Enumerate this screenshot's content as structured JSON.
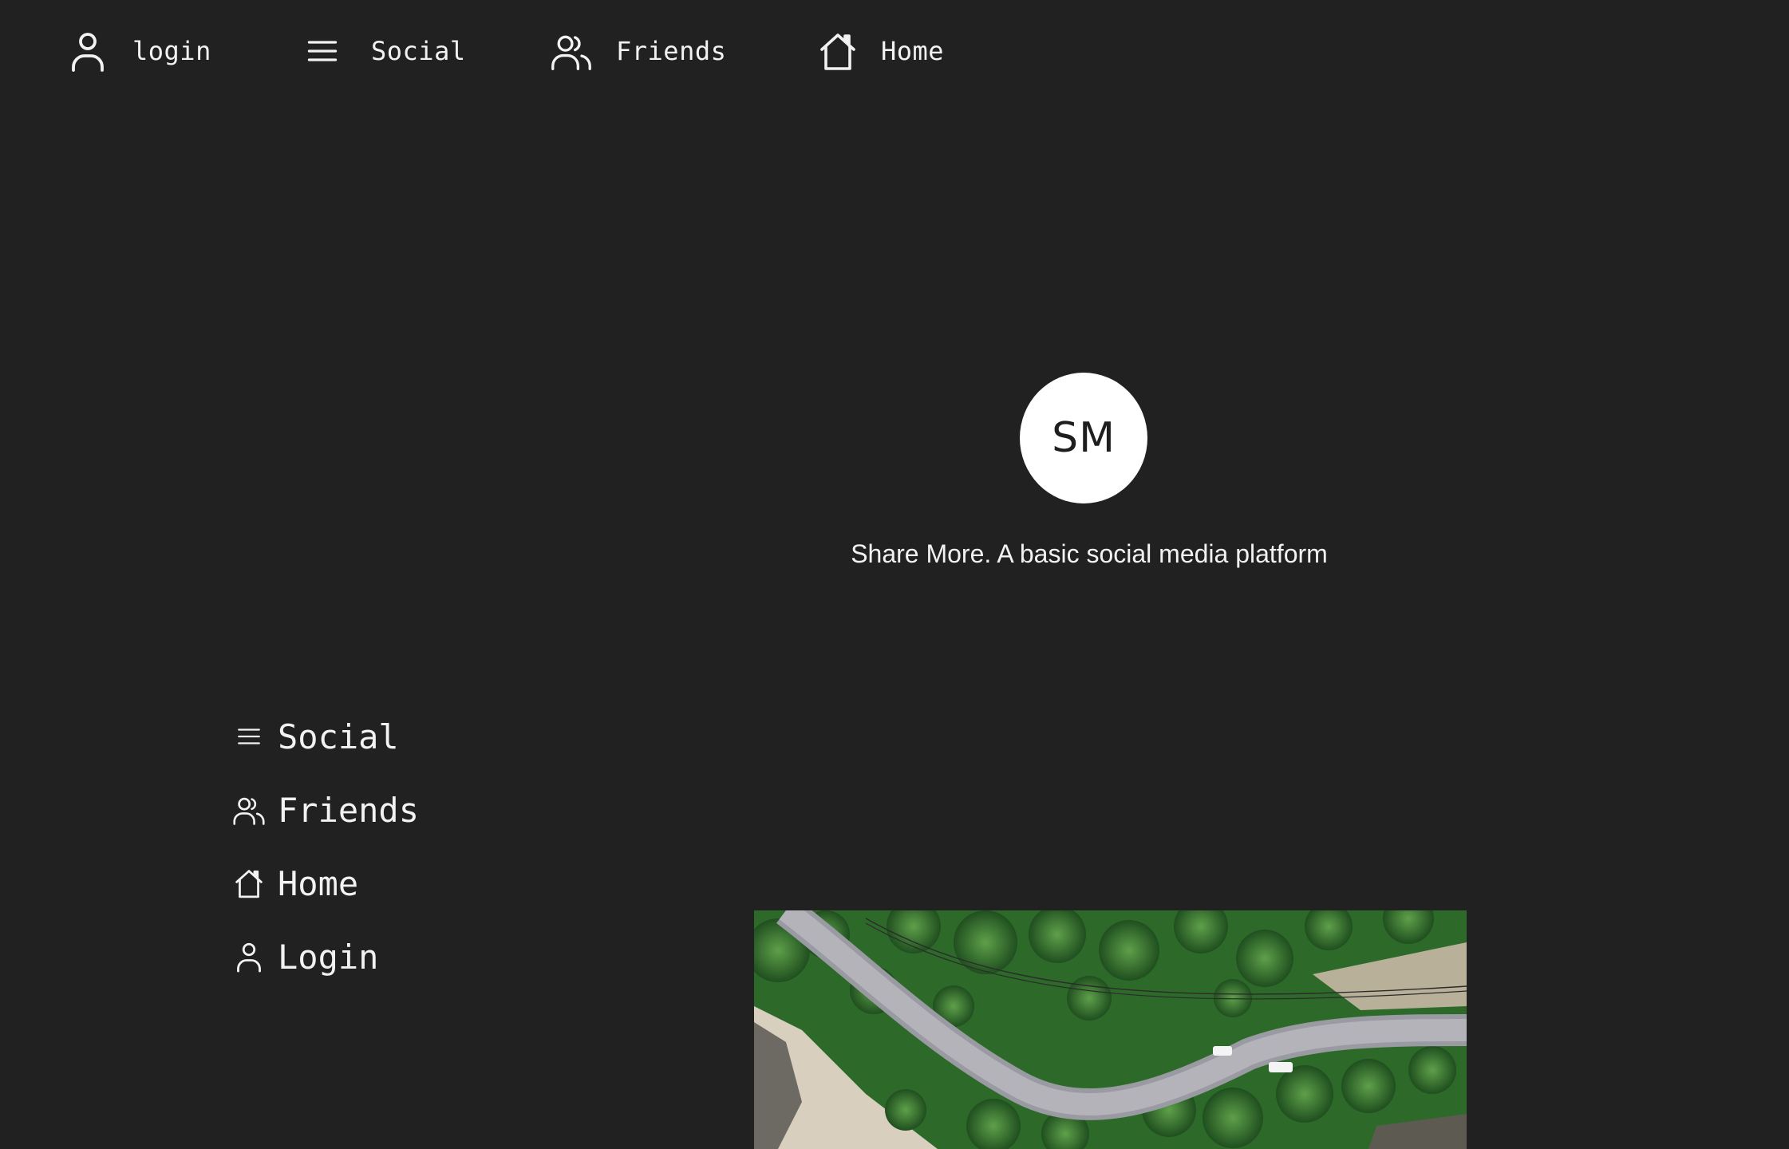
{
  "topnav": {
    "items": [
      {
        "label": "login",
        "icon": "user-icon"
      },
      {
        "label": "Social",
        "icon": "menu-icon"
      },
      {
        "label": "Friends",
        "icon": "users-icon"
      },
      {
        "label": "Home",
        "icon": "home-icon"
      }
    ]
  },
  "hero": {
    "logo_text": "SM",
    "tagline": "Share More. A basic social media platform"
  },
  "sidenav": {
    "items": [
      {
        "label": "Social",
        "icon": "menu-icon"
      },
      {
        "label": "Friends",
        "icon": "users-icon"
      },
      {
        "label": "Home",
        "icon": "home-icon"
      },
      {
        "label": "Login",
        "icon": "user-icon"
      }
    ]
  },
  "colors": {
    "background": "#212121",
    "text": "#f2f2f2",
    "logo_bg": "#ffffff"
  },
  "photo": {
    "subject": "aerial-road-through-palm-forest"
  }
}
